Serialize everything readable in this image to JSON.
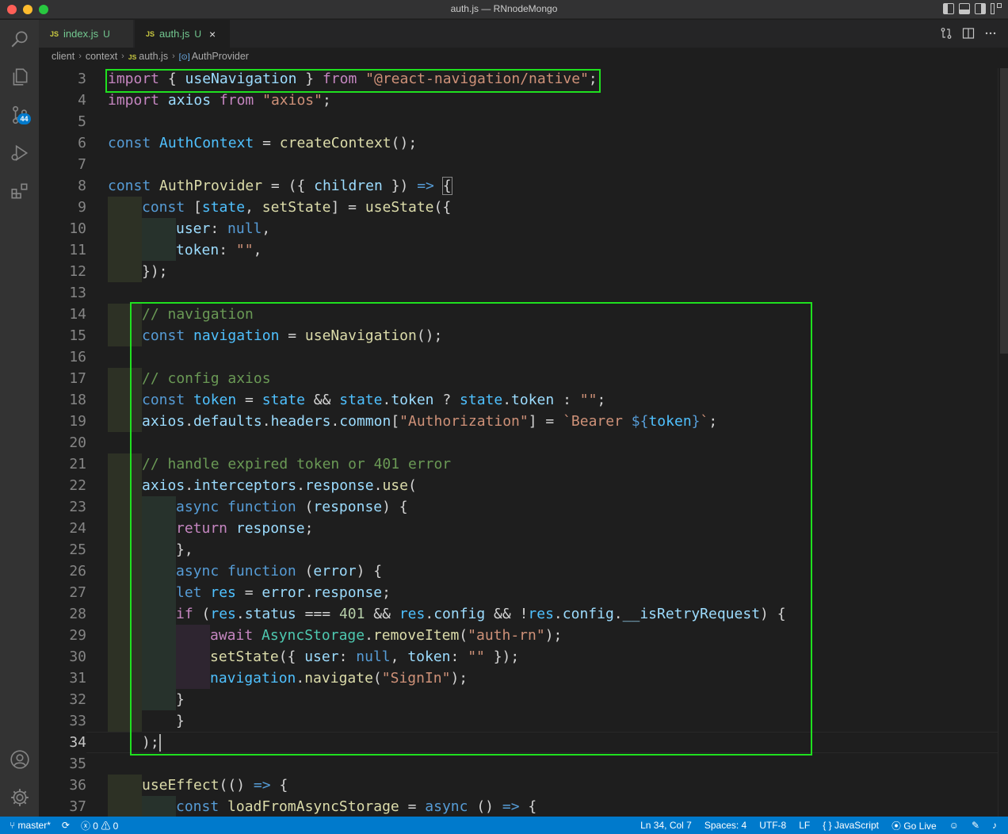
{
  "window": {
    "title": "auth.js — RNnodeMongo"
  },
  "activity_bar": {
    "scm_badge": "44"
  },
  "tabs": [
    {
      "icon": "JS",
      "name": "index.js",
      "status": "U"
    },
    {
      "icon": "JS",
      "name": "auth.js",
      "status": "U",
      "close": "×"
    }
  ],
  "breadcrumb": {
    "items": [
      "client",
      "context",
      "auth.js",
      "AuthProvider"
    ],
    "file_icon": "JS",
    "symbol_icon": "[⊙]"
  },
  "editor": {
    "line_numbers": [
      "3",
      "4",
      "5",
      "6",
      "7",
      "8",
      "9",
      "10",
      "11",
      "12",
      "13",
      "14",
      "15",
      "16",
      "17",
      "18",
      "19",
      "20",
      "21",
      "22",
      "23",
      "24",
      "25",
      "26",
      "27",
      "28",
      "29",
      "30",
      "31",
      "32",
      "33",
      "34",
      "35",
      "36",
      "37"
    ],
    "active_line": "34",
    "code": {
      "l3": [
        "import",
        " { ",
        "useNavigation",
        " } ",
        "from",
        " ",
        "\"@react-navigation/native\"",
        ";"
      ],
      "l4": [
        "import",
        " ",
        "axios",
        " ",
        "from",
        " ",
        "\"axios\"",
        ";"
      ],
      "l6": [
        "const",
        " ",
        "AuthContext",
        " = ",
        "createContext",
        "();"
      ],
      "l8": [
        "const",
        " ",
        "AuthProvider",
        " = ",
        "(",
        "{ ",
        "children",
        " }",
        ")",
        " ",
        "=>",
        " ",
        "{"
      ],
      "l9": [
        "const",
        " [",
        "state",
        ", ",
        "setState",
        "] = ",
        "useState",
        "({"
      ],
      "l10": [
        "user",
        ": ",
        "null",
        ","
      ],
      "l11": [
        "token",
        ": ",
        "\"\"",
        ","
      ],
      "l12": [
        "});"
      ],
      "l14": [
        "// navigation"
      ],
      "l15": [
        "const",
        " ",
        "navigation",
        " = ",
        "useNavigation",
        "();"
      ],
      "l17": [
        "// config axios"
      ],
      "l18": [
        "const",
        " ",
        "token",
        " = ",
        "state",
        " && ",
        "state",
        ".",
        "token",
        " ? ",
        "state",
        ".",
        "token",
        " : ",
        "\"\"",
        ";"
      ],
      "l19": [
        "axios",
        ".",
        "defaults",
        ".",
        "headers",
        ".",
        "common",
        "[",
        "\"Authorization\"",
        "] = ",
        "`Bearer ",
        "${",
        "token",
        "}",
        "`",
        ";"
      ],
      "l21": [
        "// handle expired token or 401 error"
      ],
      "l22": [
        "axios",
        ".",
        "interceptors",
        ".",
        "response",
        ".",
        "use",
        "("
      ],
      "l23": [
        "async",
        " ",
        "function",
        " (",
        "response",
        ") {"
      ],
      "l24": [
        "return",
        " ",
        "response",
        ";"
      ],
      "l25": [
        "},"
      ],
      "l26": [
        "async",
        " ",
        "function",
        " (",
        "error",
        ") {"
      ],
      "l27": [
        "let",
        " ",
        "res",
        " = ",
        "error",
        ".",
        "response",
        ";"
      ],
      "l28": [
        "if",
        " (",
        "res",
        ".",
        "status",
        " === ",
        "401",
        " && ",
        "res",
        ".",
        "config",
        " && !",
        "res",
        ".",
        "config",
        ".",
        "__isRetryRequest",
        ") {"
      ],
      "l29": [
        "await",
        " ",
        "AsyncStorage",
        ".",
        "removeItem",
        "(",
        "\"auth-rn\"",
        ");"
      ],
      "l30": [
        "setState",
        "({ ",
        "user",
        ": ",
        "null",
        ", ",
        "token",
        ": ",
        "\"\"",
        " });"
      ],
      "l31": [
        "navigation",
        ".",
        "navigate",
        "(",
        "\"SignIn\"",
        ");"
      ],
      "l32": [
        "}"
      ],
      "l33": [
        "}"
      ],
      "l34": [
        ");"
      ],
      "l36": [
        "useEffect",
        "(",
        "()",
        " ",
        "=>",
        " {"
      ],
      "l37": [
        "const",
        " ",
        "loadFromAsyncStorage",
        " = ",
        "async",
        " ",
        "()",
        " ",
        "=>",
        " {"
      ]
    }
  },
  "status_bar": {
    "branch": "master*",
    "errors": "0",
    "warnings": "0",
    "position": "Ln 34, Col 7",
    "spaces": "Spaces: 4",
    "encoding": "UTF-8",
    "eol": "LF",
    "language_icon": "{ }",
    "language": "JavaScript",
    "go_live": "Go Live"
  },
  "colors": {
    "highlight_box": "#1fe01f",
    "status_bar": "#007acc",
    "activity_bar": "#333333"
  }
}
